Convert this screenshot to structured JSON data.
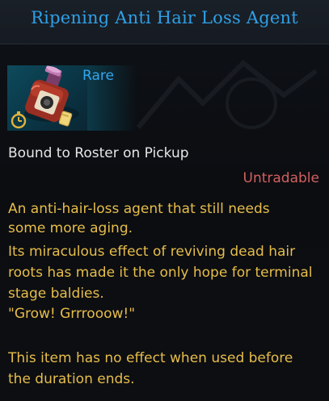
{
  "item": {
    "name": "Ripening Anti Hair Loss Agent",
    "rarity": "Rare",
    "binding": "Bound to Roster on Pickup",
    "trade_status": "Untradable",
    "description_lines": [
      "An anti-hair-loss agent that still needs",
      "some more aging.",
      "Its miraculous effect of reviving dead hair",
      "roots has made it the only hope for terminal",
      "stage baldies.",
      "\"Grow! Grrrooow!\"",
      "This item has no effect when used before",
      "the duration ends."
    ],
    "icon": "potion-bottle-icon",
    "badges": [
      "stopwatch-icon",
      "scroll-icon"
    ]
  },
  "colors": {
    "title": "#2fa0e6",
    "rarity": "#35a6ee",
    "binding": "#e6e6e6",
    "untradable": "#d2605f",
    "description": "#e7bd4a",
    "icon_background": "#0a3b4b"
  }
}
